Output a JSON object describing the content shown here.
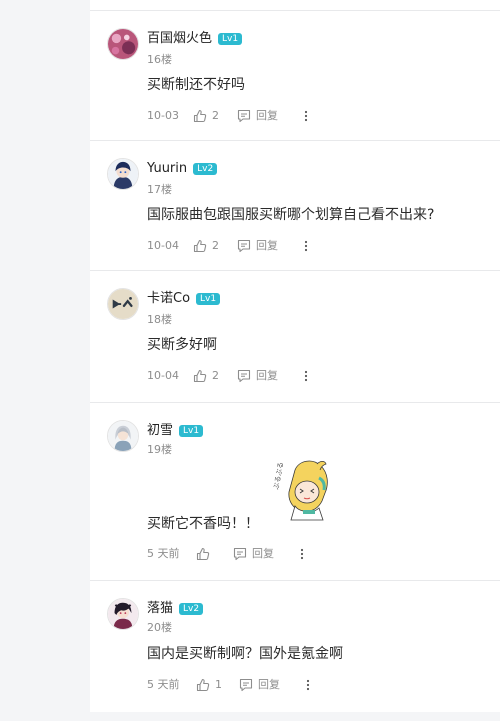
{
  "comments": [
    {
      "username": "百国烟火色",
      "level": "Lv1",
      "floor": "16楼",
      "text": "买断制还不好吗",
      "time": "10-03",
      "likes": "2",
      "reply_label": "回复"
    },
    {
      "username": "Yuurin",
      "level": "Lv2",
      "floor": "17楼",
      "text": "国际服曲包跟国服买断哪个划算自己看不出来?",
      "time": "10-04",
      "likes": "2",
      "reply_label": "回复"
    },
    {
      "username": "卡诺Co",
      "level": "Lv1",
      "floor": "18楼",
      "text": "买断多好啊",
      "time": "10-04",
      "likes": "2",
      "reply_label": "回复"
    },
    {
      "username": "初雪",
      "level": "Lv1",
      "floor": "19楼",
      "text": "买断它不香吗！！",
      "time": "5 天前",
      "likes": "",
      "reply_label": "回复",
      "sticker_text": "ぶるぶる"
    },
    {
      "username": "落猫",
      "level": "Lv2",
      "floor": "20楼",
      "text": "国内是买断制啊？国外是氪金啊",
      "time": "5 天前",
      "likes": "1",
      "reply_label": "回复"
    }
  ],
  "colors": {
    "level_badge": "#2cbad0",
    "text": "#2b2b2b",
    "muted": "#8d8d8d",
    "background": "#f4f5f7"
  },
  "icons": [
    "thumbs-up-icon",
    "comment-icon",
    "more-vertical-icon"
  ]
}
